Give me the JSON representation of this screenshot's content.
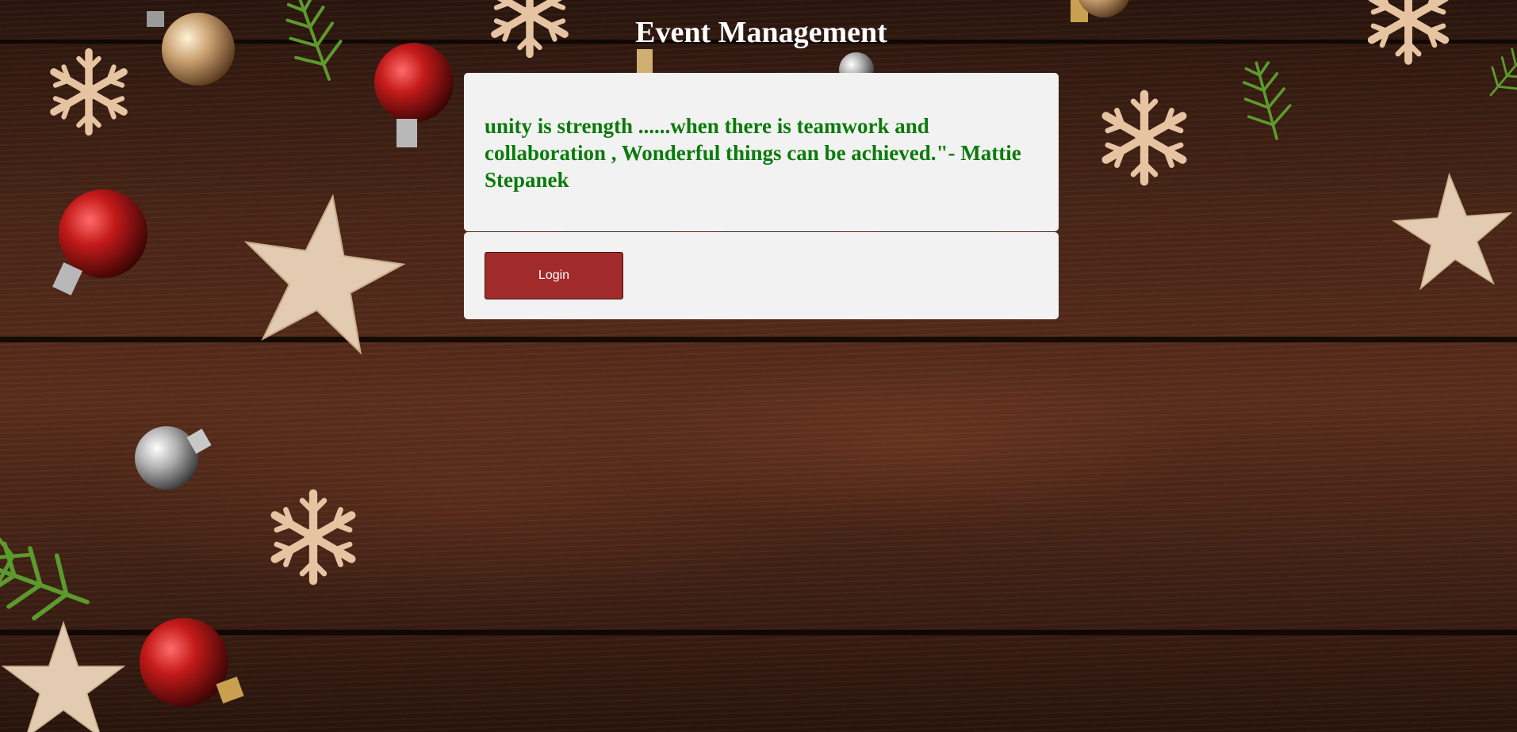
{
  "page": {
    "title": "Event Management"
  },
  "quote": {
    "text": "unity is strength ......when there is teamwork and collaboration , Wonderful things can be achieved.\"- Mattie Stepanek"
  },
  "login": {
    "button_label": "Login"
  },
  "colors": {
    "quote_text": "#0a7a0a",
    "button_bg": "#a12a2a",
    "card_bg": "#f2f2f2",
    "title": "#ffffff"
  },
  "decor_icons": [
    "snowflake-icon",
    "star-icon",
    "ornament-icon",
    "pine-branch-icon"
  ]
}
